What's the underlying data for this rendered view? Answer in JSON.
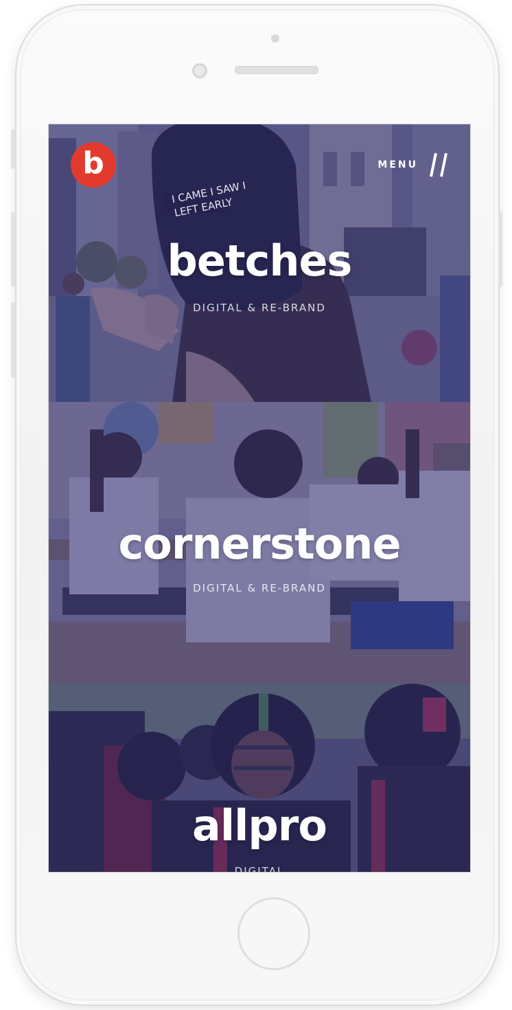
{
  "header": {
    "logo_letter": "b",
    "menu_label": "MENU",
    "menu_icon": "double-slash-icon"
  },
  "projects": [
    {
      "title": "betches",
      "subtitle": "DIGITAL & RE-BRAND",
      "cap_text": "I CAME I SAW I LEFT EARLY"
    },
    {
      "title": "cornerstone",
      "subtitle": "DIGITAL & RE-BRAND"
    },
    {
      "title": "allpro",
      "subtitle": "DIGITAL"
    }
  ],
  "colors": {
    "brand_red": "#e23a2c",
    "overlay_purple": "#302c70"
  }
}
